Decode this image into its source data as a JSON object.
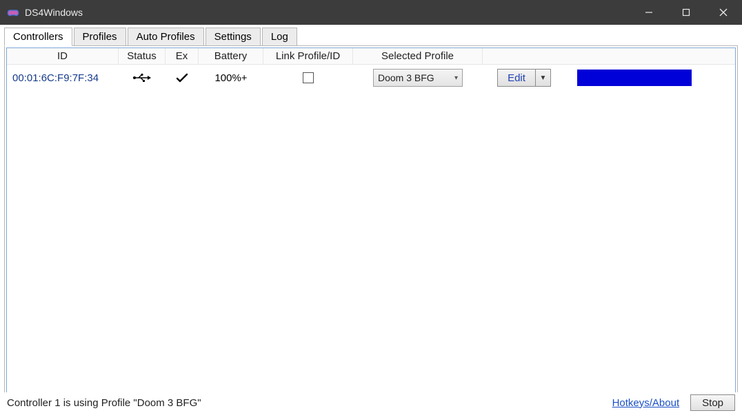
{
  "window": {
    "title": "DS4Windows"
  },
  "tabs": {
    "controllers": "Controllers",
    "profiles": "Profiles",
    "auto_profiles": "Auto Profiles",
    "settings": "Settings",
    "log": "Log"
  },
  "columns": {
    "id": "ID",
    "status": "Status",
    "ex": "Ex",
    "battery": "Battery",
    "link": "Link Profile/ID",
    "selected": "Selected Profile"
  },
  "rows": [
    {
      "id": "00:01:6C:F9:7F:34",
      "status_icon": "usb",
      "ex_icon": "check",
      "battery": "100%+",
      "link_checked": false,
      "selected_profile": "Doom 3 BFG",
      "edit_label": "Edit",
      "color": "#0000d8"
    }
  ],
  "status": {
    "message": "Controller 1 is using Profile \"Doom 3 BFG\"",
    "hotkeys_link": "Hotkeys/About",
    "stop_button": "Stop"
  }
}
